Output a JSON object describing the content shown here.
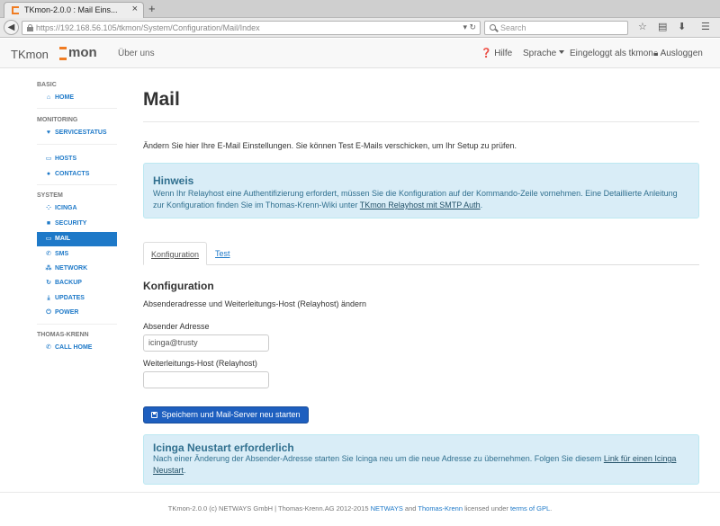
{
  "browser": {
    "tab_title": "TKmon-2.0.0 : Mail Eins...",
    "url_host": "https://192.168.56.105",
    "url_path": "/tkmon/System/Configuration/Mail/Index",
    "search_placeholder": "Search"
  },
  "header": {
    "brand": "TKmon",
    "logo_text": "mon",
    "about": "Über uns",
    "help": "Hilfe",
    "language": "Sprache",
    "logged_in": "Eingeloggt als tkmon",
    "logout": "Ausloggen"
  },
  "sidebar": {
    "sections": [
      {
        "title": "BASIC",
        "items": [
          {
            "label": "HOME",
            "icon": "home-icon"
          }
        ]
      },
      {
        "title": "MONITORING",
        "items": [
          {
            "label": "SERVICESTATUS",
            "icon": "heart-icon"
          },
          {
            "label": "HOSTS",
            "icon": "monitor-icon"
          },
          {
            "label": "CONTACTS",
            "icon": "user-icon"
          }
        ]
      },
      {
        "title": "SYSTEM",
        "items": [
          {
            "label": "ICINGA",
            "icon": "icinga-icon"
          },
          {
            "label": "SECURITY",
            "icon": "lock-icon"
          },
          {
            "label": "MAIL",
            "icon": "inbox-icon",
            "active": true
          },
          {
            "label": "SMS",
            "icon": "phone-icon"
          },
          {
            "label": "NETWORK",
            "icon": "network-icon"
          },
          {
            "label": "BACKUP",
            "icon": "refresh-icon"
          },
          {
            "label": "UPDATES",
            "icon": "download-icon"
          },
          {
            "label": "POWER",
            "icon": "power-icon"
          }
        ]
      },
      {
        "title": "THOMAS-KRENN",
        "items": [
          {
            "label": "CALL HOME",
            "icon": "phone-icon"
          }
        ]
      }
    ]
  },
  "main": {
    "title": "Mail",
    "intro": "Ändern Sie hier Ihre E-Mail Einstellungen. Sie können Test E-Mails verschicken, um Ihr Setup zu prüfen.",
    "hint": {
      "title": "Hinweis",
      "text": "Wenn Ihr Relayhost eine Authentifizierung erfordert, müssen Sie die Konfiguration auf der Kommando-Zeile vornehmen. Eine Detaillierte Anleitung zur Konfiguration finden Sie im Thomas-Krenn-Wiki unter ",
      "link": "TKmon Relayhost mit SMTP Auth",
      "after": "."
    },
    "tabs": [
      {
        "label": "Konfiguration",
        "active": true
      },
      {
        "label": "Test"
      }
    ],
    "section_title": "Konfiguration",
    "section_sub": "Absenderadresse und Weiterleitungs-Host (Relayhost) ändern",
    "sender_label": "Absender Adresse",
    "sender_value": "icinga@trusty",
    "relay_label": "Weiterleitungs-Host (Relayhost)",
    "relay_value": "",
    "save_button": "Speichern und Mail-Server neu starten",
    "restart": {
      "title": "Icinga Neustart erforderlich",
      "text": "Nach einer Änderung der Absender-Adresse starten Sie Icinga neu um die neue Adresse zu übernehmen. Folgen Sie diesem ",
      "link": "Link für einen Icinga Neustart",
      "after": "."
    }
  },
  "footer": {
    "prefix": "TKmon-2.0.0 (c) NETWAYS GmbH | Thomas-Krenn.AG 2012-2015 ",
    "netways": "NETWAYS",
    "and": " and ",
    "tk": "Thomas-Krenn",
    "licensed": " licensed under ",
    "license": "terms of GPL",
    "end": "."
  },
  "colors": {
    "accent": "#1e79c8",
    "logo_orange": "#f07c22",
    "alert_bg": "#d9edf7"
  }
}
